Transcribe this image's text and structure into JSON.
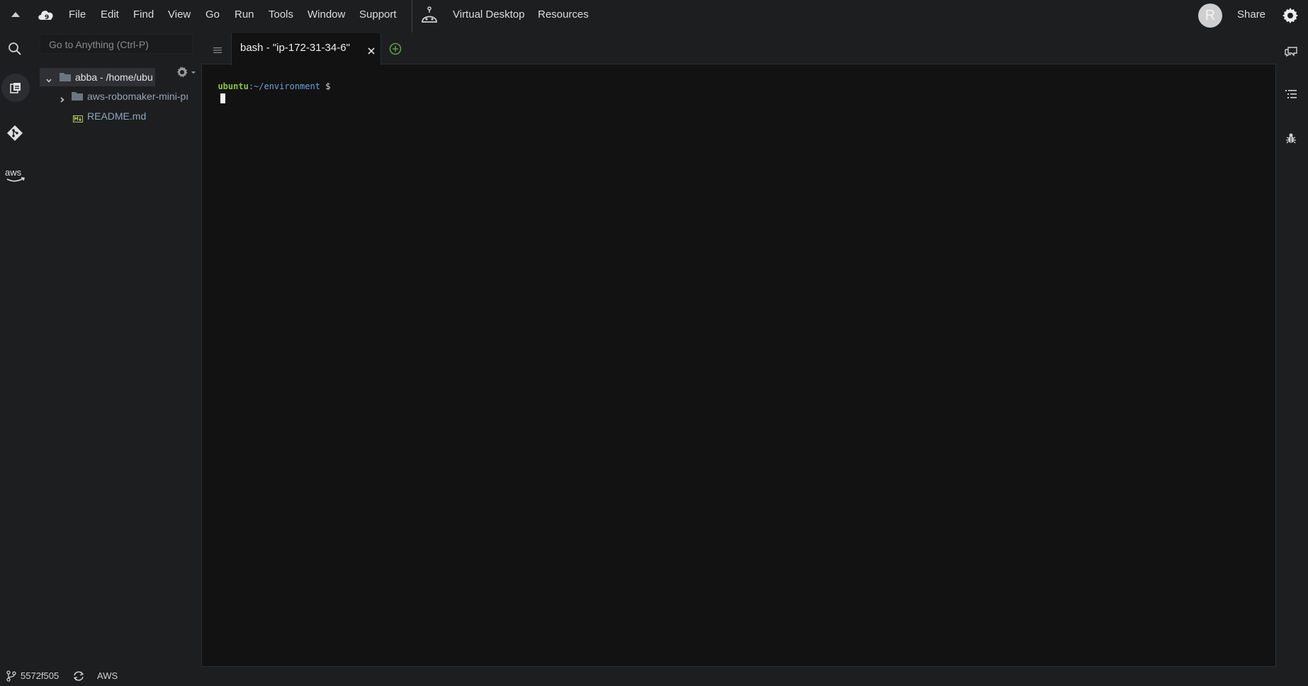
{
  "menubar": {
    "items": [
      "File",
      "Edit",
      "Find",
      "View",
      "Go",
      "Run",
      "Tools",
      "Window",
      "Support"
    ],
    "virtual_desktop": "Virtual Desktop",
    "resources": "Resources",
    "share": "Share",
    "avatar_letter": "R"
  },
  "sidebar": {
    "search_placeholder": "Go to Anything (Ctrl-P)",
    "tree": {
      "root": "abba - /home/ubu",
      "folder": "aws-robomaker-mini-pı",
      "file": "README.md"
    }
  },
  "editor": {
    "tab_title": "bash - \"ip-172-31-34-6\"",
    "terminal": {
      "user": "ubuntu",
      "path": ":~/environment",
      "prompt": " $"
    }
  },
  "statusbar": {
    "commit": "5572f505",
    "provider": "AWS"
  },
  "colors": {
    "background": "#1d1e20",
    "terminal_bg": "#121212",
    "terminal_user": "#8ec24e",
    "terminal_path": "#6f9fd8",
    "folder": "#6b7680",
    "tree_text": "#9aa4ad",
    "add_tab": "#5d9b44"
  },
  "icons": [
    "collapse-up-icon",
    "cloud9-icon",
    "robot-icon",
    "avatar",
    "gear-icon",
    "search-icon",
    "files-icon",
    "git-icon",
    "aws-icon",
    "chat-icon",
    "outline-icon",
    "debug-icon",
    "branch-icon",
    "sync-icon",
    "panel-menu-icon",
    "close-icon",
    "add-tab-icon",
    "folder-icon",
    "markdown-file-icon",
    "chevron-down-icon",
    "chevron-right-icon",
    "settings-gear-icon"
  ]
}
